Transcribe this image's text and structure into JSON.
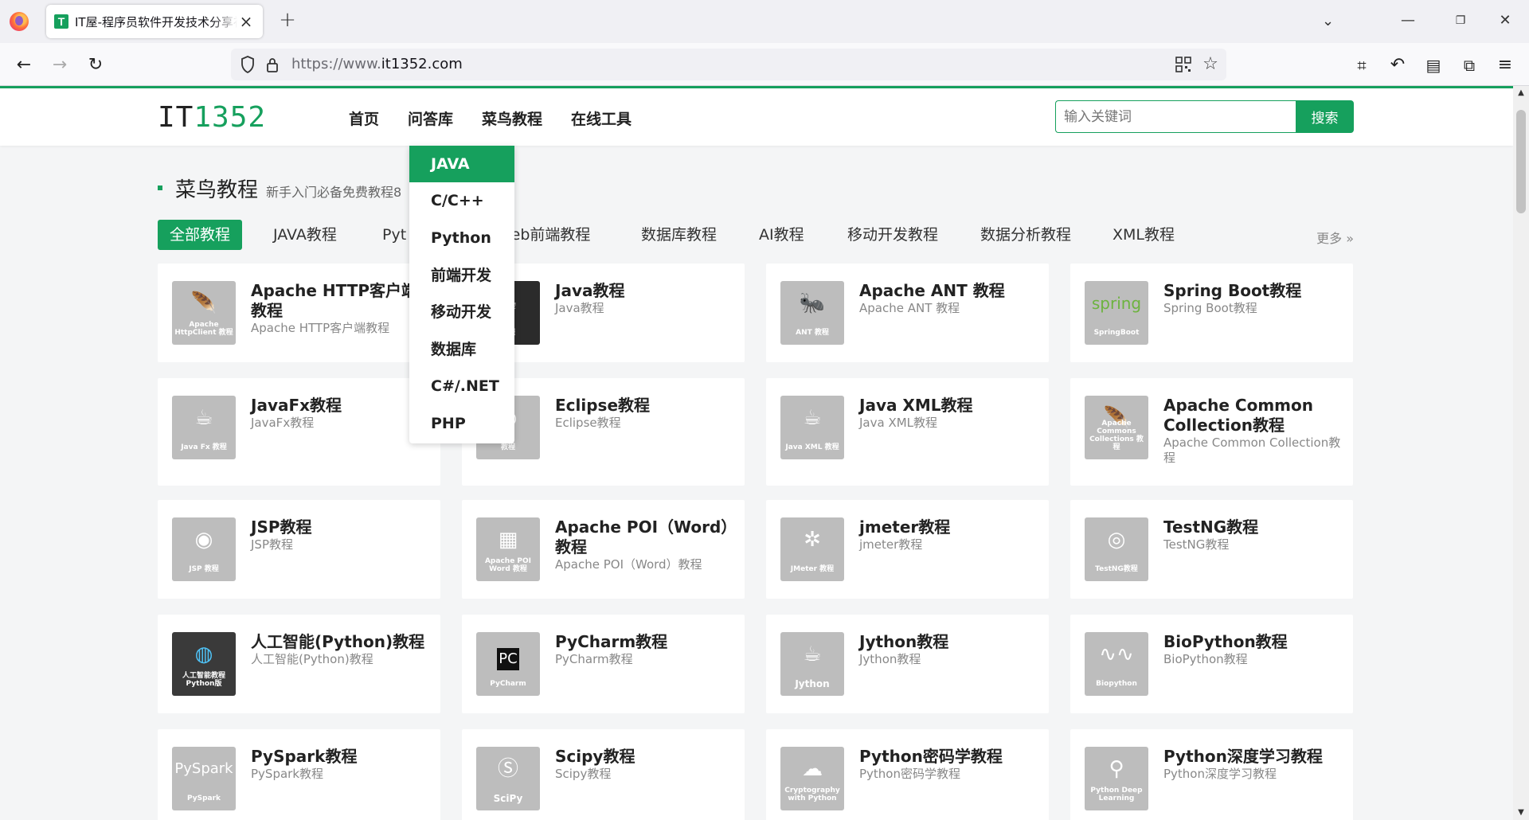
{
  "browser": {
    "tab_title": "IT屋-程序员软件开发技术分享社区",
    "tab_favicon": "T",
    "url_proto": "https://www.",
    "url_host": "it1352.com"
  },
  "site": {
    "logo_it": "IT",
    "logo_num": "1352",
    "nav": [
      "首页",
      "问答库",
      "菜鸟教程",
      "在线工具"
    ],
    "search_placeholder": "输入关键词",
    "search_button": "搜索",
    "dropdown": [
      "JAVA",
      "C/C++",
      "Python",
      "前端开发",
      "移动开发",
      "数据库",
      "C#/.NET",
      "PHP"
    ]
  },
  "section": {
    "title": "菜鸟教程",
    "subtitle": "新手入门必备免费教程8",
    "filters": [
      "全部教程",
      "JAVA教程",
      "Pyt",
      "Web前端教程",
      "数据库教程",
      "AI教程",
      "移动开发教程",
      "数据分析教程",
      "XML教程"
    ],
    "more": "更多 »"
  },
  "cards": [
    {
      "title": "Apache HTTP客户端教程",
      "desc": "Apache HTTP客户端教程",
      "thumb": "Apache HttpClient 教程",
      "icon": "feather-icon"
    },
    {
      "title": "Java教程",
      "desc": "Java教程",
      "thumb": "教程",
      "icon": "java-icon"
    },
    {
      "title": "Apache ANT 教程",
      "desc": "Apache ANT 教程",
      "thumb": "ANT 教程",
      "icon": "ant-icon"
    },
    {
      "title": "Spring Boot教程",
      "desc": "Spring Boot教程",
      "thumb": "SpringBoot",
      "icon": "spring-icon"
    },
    {
      "title": "JavaFx教程",
      "desc": "JavaFx教程",
      "thumb": "Java Fx 教程",
      "icon": "coffee-icon"
    },
    {
      "title": "Eclipse教程",
      "desc": "Eclipse教程",
      "thumb": "教程",
      "icon": "eclipse-icon"
    },
    {
      "title": "Java XML教程",
      "desc": "Java XML教程",
      "thumb": "Java XML 教程",
      "icon": "coffee-icon"
    },
    {
      "title": "Apache Common Collection教程",
      "desc": "Apache Common Collection教程",
      "thumb": "Apache Commons Collections 教程",
      "icon": "feather-icon"
    },
    {
      "title": "JSP教程",
      "desc": "JSP教程",
      "thumb": "JSP 教程",
      "icon": "jsp-icon"
    },
    {
      "title": "Apache POI（Word）教程",
      "desc": "Apache POI（Word）教程",
      "thumb": "Apache POI Word 教程",
      "icon": "document-icon"
    },
    {
      "title": "jmeter教程",
      "desc": "jmeter教程",
      "thumb": "JMeter 教程",
      "icon": "jmeter-icon"
    },
    {
      "title": "TestNG教程",
      "desc": "TestNG教程",
      "thumb": "TestNG教程",
      "icon": "eye-icon"
    },
    {
      "title": "人工智能(Python)教程",
      "desc": "人工智能(Python)教程",
      "thumb": "人工智能教程 Python版",
      "icon": "brain-icon"
    },
    {
      "title": "PyCharm教程",
      "desc": "PyCharm教程",
      "thumb": "PyCharm",
      "icon": "pycharm-icon"
    },
    {
      "title": "Jython教程",
      "desc": "Jython教程",
      "thumb": "Jython",
      "icon": "coffee-icon"
    },
    {
      "title": "BioPython教程",
      "desc": "BioPython教程",
      "thumb": "Biopython",
      "icon": "dna-icon"
    },
    {
      "title": "PySpark教程",
      "desc": "PySpark教程",
      "thumb": "PySpark",
      "icon": "pyspark-icon"
    },
    {
      "title": "Scipy教程",
      "desc": "Scipy教程",
      "thumb": "SciPy",
      "icon": "scipy-icon"
    },
    {
      "title": "Python密码学教程",
      "desc": "Python密码学教程",
      "thumb": "Cryptography with Python",
      "icon": "crypto-icon"
    },
    {
      "title": "Python深度学习教程",
      "desc": "Python深度学习教程",
      "thumb": "Python Deep Learning",
      "icon": "deep-learning-icon"
    }
  ],
  "colors": {
    "accent": "#16a05d"
  }
}
